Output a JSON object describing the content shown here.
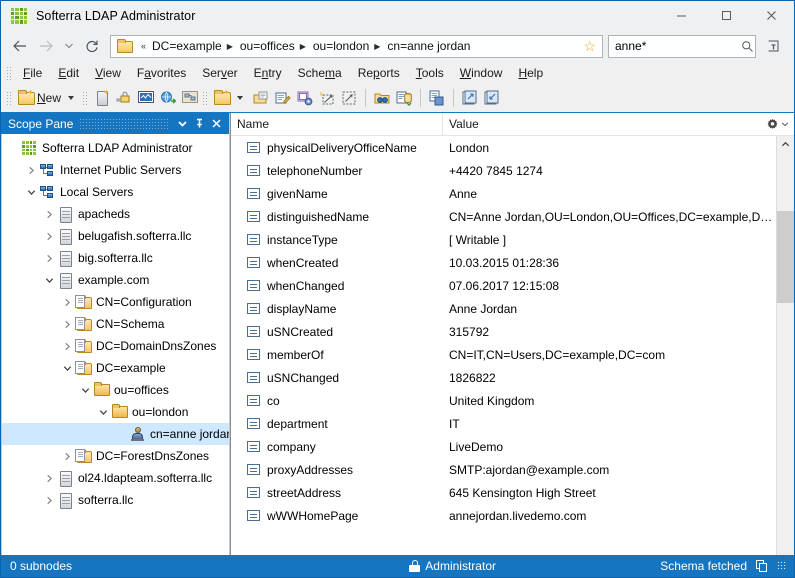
{
  "window": {
    "title": "Softerra LDAP Administrator",
    "icon": "app-grid-icon",
    "controls": {
      "minimize": "minimize-icon",
      "maximize": "maximize-icon",
      "close": "close-icon"
    }
  },
  "addressbar": {
    "back": "back-arrow-icon",
    "forward": "forward-arrow-icon",
    "history": "history-dropdown-icon",
    "refresh": "refresh-icon",
    "folder_icon": "folder-icon",
    "overflow": "«",
    "crumbs": [
      "DC=example",
      "ou=offices",
      "ou=london",
      "cn=anne jordan"
    ],
    "favorite_icon": "star-icon",
    "search": {
      "value": "anne*",
      "placeholder": "Search",
      "icon": "search-icon"
    },
    "plugin_button": "plugin-icon"
  },
  "menubar": {
    "items": [
      {
        "label": "File",
        "mnemonic": "F"
      },
      {
        "label": "Edit",
        "mnemonic": "E"
      },
      {
        "label": "View",
        "mnemonic": "V"
      },
      {
        "label": "Favorites",
        "mnemonic": "a"
      },
      {
        "label": "Server",
        "mnemonic": "v"
      },
      {
        "label": "Entry",
        "mnemonic": "n"
      },
      {
        "label": "Schema",
        "mnemonic": "m"
      },
      {
        "label": "Reports",
        "mnemonic": "p"
      },
      {
        "label": "Tools",
        "mnemonic": "T"
      },
      {
        "label": "Window",
        "mnemonic": "W"
      },
      {
        "label": "Help",
        "mnemonic": "H"
      }
    ]
  },
  "toolbar": {
    "new_label": "New",
    "new_mnemonic": "N",
    "buttons": [
      "new-entry-icon",
      "new-server-icon",
      "bind-icon",
      "statistics-icon",
      "browse-web-icon",
      "directory-icon",
      "new-folder-icon",
      "open-folder-icon",
      "edit-entry-icon",
      "entry-properties-icon",
      "new-search-icon",
      "expand-icon",
      "search-icon",
      "import-icon",
      "copy-entry-icon",
      "export-icon",
      "import-entry-icon"
    ]
  },
  "scope_pane": {
    "title": "Scope Pane",
    "menu_icon": "chevron-down-icon",
    "pin_icon": "pin-icon",
    "close_icon": "close-icon",
    "tree": [
      {
        "label": "Softerra LDAP Administrator",
        "icon": "app-grid-icon",
        "indent": 0,
        "twist": "none",
        "selected": false
      },
      {
        "label": "Internet Public Servers",
        "icon": "network-icon",
        "indent": 1,
        "twist": "collapsed",
        "selected": false
      },
      {
        "label": "Local Servers",
        "icon": "network-icon",
        "indent": 1,
        "twist": "expanded",
        "selected": false
      },
      {
        "label": "apacheds",
        "icon": "server-icon",
        "indent": 2,
        "twist": "collapsed",
        "selected": false
      },
      {
        "label": "belugafish.softerra.llc",
        "icon": "server-icon",
        "indent": 2,
        "twist": "collapsed",
        "selected": false
      },
      {
        "label": "big.softerra.llc",
        "icon": "server-icon",
        "indent": 2,
        "twist": "collapsed",
        "selected": false
      },
      {
        "label": "example.com",
        "icon": "server-icon",
        "indent": 2,
        "twist": "expanded",
        "selected": false
      },
      {
        "label": "CN=Configuration",
        "icon": "folder-doc-icon",
        "indent": 3,
        "twist": "collapsed",
        "selected": false
      },
      {
        "label": "CN=Schema",
        "icon": "folder-doc-icon",
        "indent": 3,
        "twist": "collapsed",
        "selected": false
      },
      {
        "label": "DC=DomainDnsZones",
        "icon": "folder-doc-icon",
        "indent": 3,
        "twist": "collapsed",
        "selected": false
      },
      {
        "label": "DC=example",
        "icon": "folder-doc-icon",
        "indent": 3,
        "twist": "expanded",
        "selected": false
      },
      {
        "label": "ou=offices",
        "icon": "folder-icon",
        "indent": 4,
        "twist": "expanded",
        "selected": false
      },
      {
        "label": "ou=london",
        "icon": "folder-icon",
        "indent": 5,
        "twist": "expanded",
        "selected": false
      },
      {
        "label": "cn=anne jordan",
        "icon": "user-icon",
        "indent": 6,
        "twist": "none",
        "selected": true
      },
      {
        "label": "DC=ForestDnsZones",
        "icon": "folder-doc-icon",
        "indent": 3,
        "twist": "collapsed",
        "selected": false
      },
      {
        "label": "ol24.ldapteam.softerra.llc",
        "icon": "server-icon",
        "indent": 2,
        "twist": "collapsed",
        "selected": false
      },
      {
        "label": "softerra.llc",
        "icon": "server-icon",
        "indent": 2,
        "twist": "collapsed",
        "selected": false
      }
    ]
  },
  "list_pane": {
    "columns": [
      "Name",
      "Value"
    ],
    "settings_icon": "gear-icon",
    "settings_caret": "chevron-down-icon",
    "scroll_up_icon": "chevron-up-icon",
    "rows": [
      {
        "name": "physicalDeliveryOfficeName",
        "value": "London"
      },
      {
        "name": "telephoneNumber",
        "value": "+4420 7845 1274"
      },
      {
        "name": "givenName",
        "value": "Anne"
      },
      {
        "name": "distinguishedName",
        "value": "CN=Anne Jordan,OU=London,OU=Offices,DC=example,DC…"
      },
      {
        "name": "instanceType",
        "value": "[ Writable ]"
      },
      {
        "name": "whenCreated",
        "value": "10.03.2015 01:28:36"
      },
      {
        "name": "whenChanged",
        "value": "07.06.2017 12:15:08"
      },
      {
        "name": "displayName",
        "value": "Anne Jordan"
      },
      {
        "name": "uSNCreated",
        "value": "315792"
      },
      {
        "name": "memberOf",
        "value": "CN=IT,CN=Users,DC=example,DC=com"
      },
      {
        "name": "uSNChanged",
        "value": "1826822"
      },
      {
        "name": "co",
        "value": "United Kingdom"
      },
      {
        "name": "department",
        "value": "IT"
      },
      {
        "name": "company",
        "value": "LiveDemo"
      },
      {
        "name": "proxyAddresses",
        "value": "SMTP:ajordan@example.com"
      },
      {
        "name": "streetAddress",
        "value": "645 Kensington High Street"
      },
      {
        "name": "wWWHomePage",
        "value": "annejordan.livedemo.com"
      }
    ]
  },
  "statusbar": {
    "subnodes": "0 subnodes",
    "user": "Administrator",
    "user_icon": "lock-icon",
    "schema": "Schema fetched",
    "copy_icon": "copy-icon",
    "resize_grip": "resize-grip-icon"
  },
  "colors": {
    "accent": "#1675c0",
    "title_border": "#0a64ad",
    "selection": "#cde8ff",
    "chrome": "#f0f0f0"
  }
}
